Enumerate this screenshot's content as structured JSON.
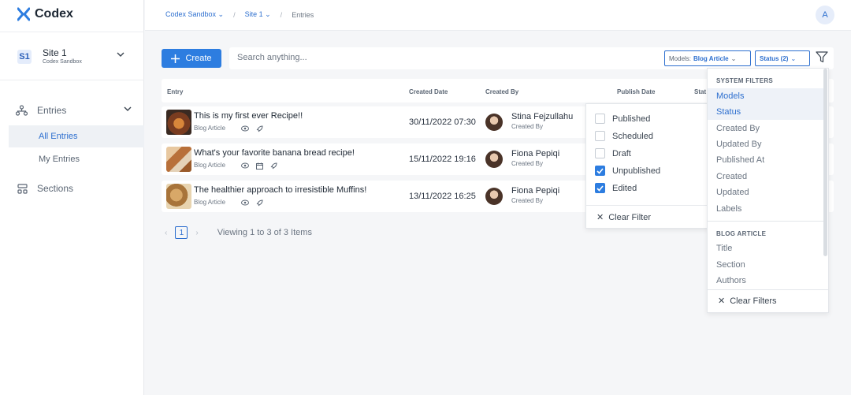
{
  "app": {
    "name": "Codex"
  },
  "sidebar": {
    "site_badge": "S1",
    "site_name": "Site 1",
    "site_org": "Codex Sandbox",
    "nav": [
      {
        "label": "Entries"
      },
      {
        "label": "All Entries"
      },
      {
        "label": "My Entries"
      },
      {
        "label": "Sections"
      }
    ]
  },
  "breadcrumbs": [
    {
      "label": "Codex Sandbox"
    },
    {
      "label": "Site 1"
    },
    {
      "label": "Entries"
    }
  ],
  "user": {
    "initial": "A"
  },
  "toolbar": {
    "create_label": "Create",
    "search_placeholder": "Search anything...",
    "models_prefix": "Models:",
    "models_value": "Blog Article",
    "status_label": "Status (2)"
  },
  "table": {
    "columns": [
      "Entry",
      "Created Date",
      "Created By",
      "Publish Date",
      "Stat"
    ],
    "rows": [
      {
        "title": "This is my first ever Recipe!!",
        "model": "Blog Article",
        "created": "30/11/2022 07:30",
        "author": "Stina Fejzullahu",
        "role": "Created By",
        "thumb_color": "#8a4a2a"
      },
      {
        "title": "What's your favorite banana bread recipe!",
        "model": "Blog Article",
        "created": "15/11/2022 19:16",
        "author": "Fiona Pepiqi",
        "role": "Created By",
        "thumb_color": "#b8855a"
      },
      {
        "title": "The healthier approach to irresistible Muffins!",
        "model": "Blog Article",
        "created": "13/11/2022 16:25",
        "author": "Fiona Pepiqi",
        "role": "Created By",
        "thumb_color": "#c8a070"
      }
    ]
  },
  "pagination": {
    "page": "1",
    "summary": "Viewing 1 to 3 of 3 Items"
  },
  "status_dropdown": {
    "options": [
      {
        "label": "Published",
        "checked": false
      },
      {
        "label": "Scheduled",
        "checked": false
      },
      {
        "label": "Draft",
        "checked": false
      },
      {
        "label": "Unpublished",
        "checked": true
      },
      {
        "label": "Edited",
        "checked": true
      }
    ],
    "clear_label": "Clear Filter"
  },
  "filter_panel": {
    "system_heading": "SYSTEM FILTERS",
    "system_items": [
      "Models",
      "Status",
      "Created By",
      "Updated By",
      "Published At",
      "Created",
      "Updated",
      "Labels"
    ],
    "blog_heading": "BLOG ARTICLE",
    "blog_items": [
      "Title",
      "Section",
      "Authors"
    ],
    "clear_label": "Clear Filters"
  },
  "colors": {
    "accent": "#2d7de0",
    "link": "#2d6fcf"
  }
}
